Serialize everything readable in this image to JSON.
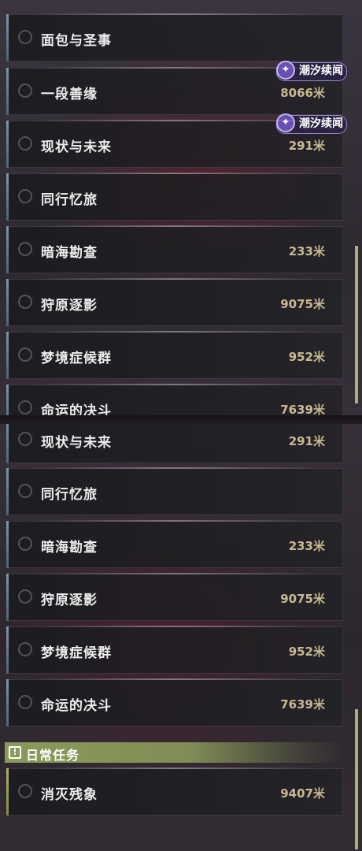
{
  "top_list": [
    {
      "name": "面包与圣事",
      "distance": ""
    },
    {
      "name": "一段善缘",
      "distance": "8066米",
      "badge": "潮汐续闻"
    },
    {
      "name": "现状与未来",
      "distance": "291米",
      "badge": "潮汐续闻"
    },
    {
      "name": "同行忆旅",
      "distance": ""
    },
    {
      "name": "暗海勘查",
      "distance": "233米"
    },
    {
      "name": "狩原逐影",
      "distance": "9075米"
    },
    {
      "name": "梦境症候群",
      "distance": "952米"
    },
    {
      "name": "命运的决斗",
      "distance": "7639米"
    }
  ],
  "bottom_list": [
    {
      "name": "现状与未来",
      "distance": "291米"
    },
    {
      "name": "同行忆旅",
      "distance": ""
    },
    {
      "name": "暗海勘查",
      "distance": "233米"
    },
    {
      "name": "狩原逐影",
      "distance": "9075米"
    },
    {
      "name": "梦境症候群",
      "distance": "952米"
    },
    {
      "name": "命运的决斗",
      "distance": "7639米"
    }
  ],
  "daily_section": {
    "icon": "exclamation-box-icon",
    "title": "日常任务",
    "items": [
      {
        "name": "消灭残象",
        "distance": "9407米"
      }
    ]
  },
  "colors": {
    "accent_blue": "#7e96a6",
    "accent_green": "#8a9a5a",
    "distance_text": "#c9b993",
    "badge_purple": "#6a4fb3"
  }
}
